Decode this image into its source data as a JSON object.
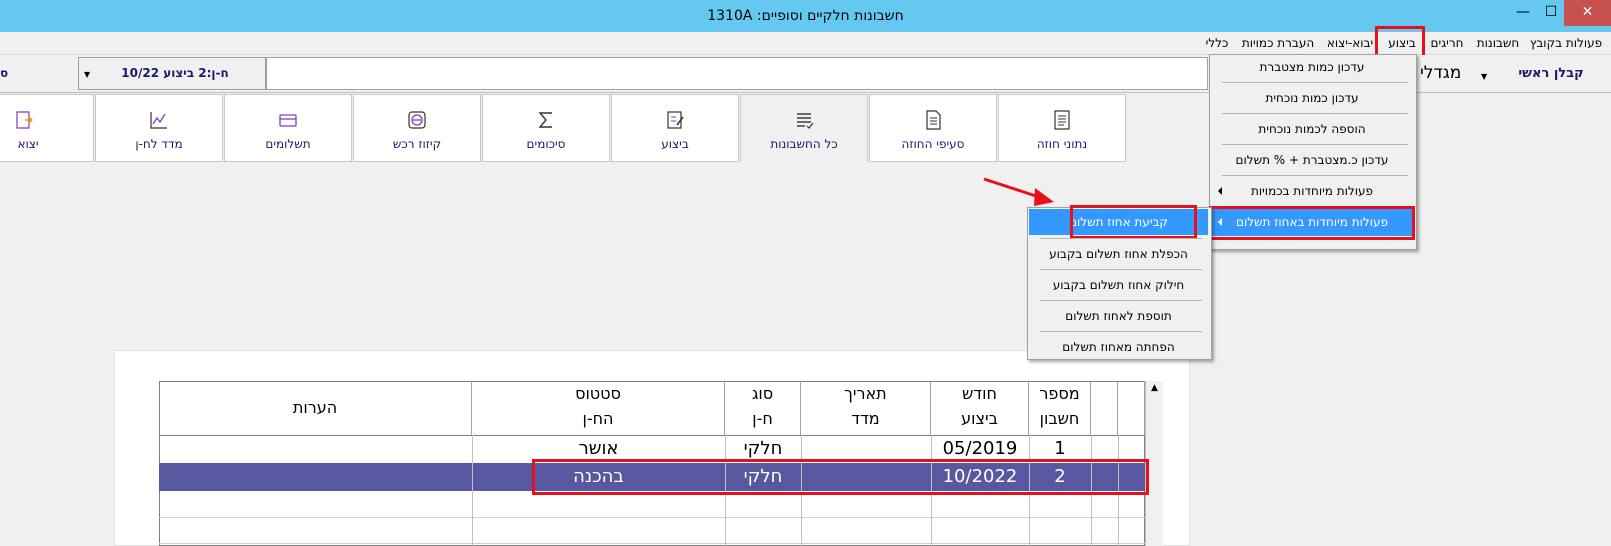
{
  "window": {
    "title": "1310A :חשבונות חלקיים וסופיים",
    "min_glyph": "—",
    "max_glyph": "☐",
    "close_glyph": "✕"
  },
  "menubar": {
    "items": [
      "פעולות בקובץ",
      "חשבונות",
      "חריגים",
      "ביצוע",
      "יבוא-יצוא",
      "העברת כמויות",
      "כללי"
    ]
  },
  "fields": {
    "contractor": "קבלן ראשי",
    "project": "מגדלי",
    "account": "ח-ן:2 ביצוע 10/22",
    "left_cut": "ס"
  },
  "tabs": [
    {
      "label": "נתוני חוזה",
      "icon": "document-list-icon"
    },
    {
      "label": "סעיפי החוזה",
      "icon": "document-lines-icon"
    },
    {
      "label": "כל החשבונות",
      "icon": "list-check-icon",
      "selected": true
    },
    {
      "label": "ביצוע",
      "icon": "edit-form-icon"
    },
    {
      "label": "סיכומים",
      "icon": "sigma-icon"
    },
    {
      "label": "קיזוז רכש",
      "icon": "minus-circle-icon"
    },
    {
      "label": "תשלומים",
      "icon": "card-icon"
    },
    {
      "label": "מדד לח-ן",
      "icon": "chart-icon"
    },
    {
      "label": "יצוא",
      "icon": "export-icon"
    }
  ],
  "menu_bitzua": {
    "items": [
      "עדכון כמות מצטברת",
      "עדכון כמות נוכחית",
      "הוספה לכמות נוכחית",
      "עדכון כ.מצטברת + % תשלום",
      "פעולות מיוחדות בכמויות",
      "פעולות מיוחדות באחוז תשלום"
    ]
  },
  "submenu": {
    "items": [
      "קביעת אחוז תשלום",
      "הכפלת אחוז תשלום בקבוע",
      "חילוק אחוז תשלום בקבוע",
      "תוספת לאחוז תשלום",
      "הפחתה מאחוז תשלום"
    ]
  },
  "grid": {
    "headers": [
      {
        "l1": "מספר",
        "l2": "חשבון"
      },
      {
        "l1": "חודש",
        "l2": "ביצוע"
      },
      {
        "l1": "תאריך",
        "l2": "מדד"
      },
      {
        "l1": "סוג",
        "l2": "ח-ן"
      },
      {
        "l1": "סטטוס",
        "l2": "הח-ן"
      },
      {
        "l1": "הערות",
        "l2": ""
      }
    ],
    "rows": [
      {
        "num": "1",
        "month": "05/2019",
        "index_date": "",
        "type": "חלקי",
        "status": "אושר",
        "notes": ""
      },
      {
        "num": "2",
        "month": "10/2022",
        "index_date": "",
        "type": "חלקי",
        "status": "בהכנה",
        "notes": ""
      }
    ]
  },
  "colors": {
    "titlebar": "#64c8f0",
    "selected_row": "#5858a0",
    "highlight": "#3399ff",
    "annotation_red": "#e8101a"
  }
}
